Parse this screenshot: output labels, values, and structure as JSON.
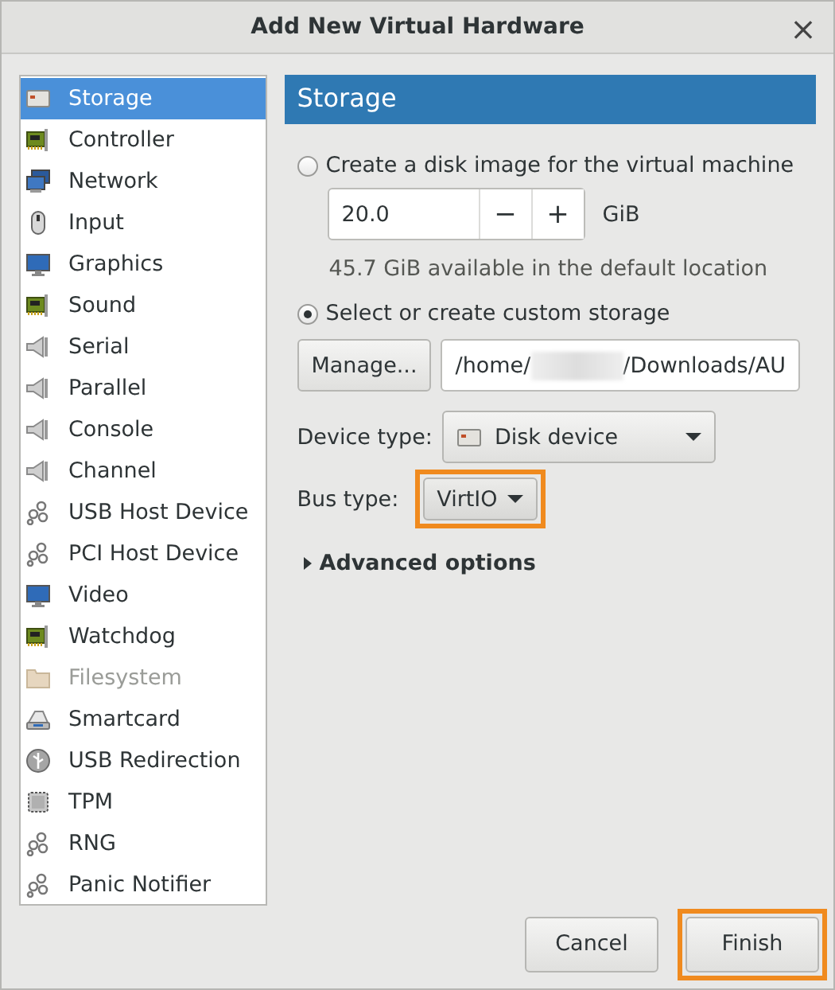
{
  "window": {
    "title": "Add New Virtual Hardware",
    "close": "×"
  },
  "sidebar": {
    "items": [
      {
        "label": "Storage",
        "kind": "disk",
        "selected": true,
        "disabled": false
      },
      {
        "label": "Controller",
        "kind": "card",
        "selected": false,
        "disabled": false
      },
      {
        "label": "Network",
        "kind": "network",
        "selected": false,
        "disabled": false
      },
      {
        "label": "Input",
        "kind": "mouse",
        "selected": false,
        "disabled": false
      },
      {
        "label": "Graphics",
        "kind": "monitor",
        "selected": false,
        "disabled": false
      },
      {
        "label": "Sound",
        "kind": "card",
        "selected": false,
        "disabled": false
      },
      {
        "label": "Serial",
        "kind": "plug",
        "selected": false,
        "disabled": false
      },
      {
        "label": "Parallel",
        "kind": "plug",
        "selected": false,
        "disabled": false
      },
      {
        "label": "Console",
        "kind": "plug",
        "selected": false,
        "disabled": false
      },
      {
        "label": "Channel",
        "kind": "plug",
        "selected": false,
        "disabled": false
      },
      {
        "label": "USB Host Device",
        "kind": "gears",
        "selected": false,
        "disabled": false
      },
      {
        "label": "PCI Host Device",
        "kind": "gears",
        "selected": false,
        "disabled": false
      },
      {
        "label": "Video",
        "kind": "monitor",
        "selected": false,
        "disabled": false
      },
      {
        "label": "Watchdog",
        "kind": "card",
        "selected": false,
        "disabled": false
      },
      {
        "label": "Filesystem",
        "kind": "folder",
        "selected": false,
        "disabled": true
      },
      {
        "label": "Smartcard",
        "kind": "reader",
        "selected": false,
        "disabled": false
      },
      {
        "label": "USB Redirection",
        "kind": "usb",
        "selected": false,
        "disabled": false
      },
      {
        "label": "TPM",
        "kind": "chip",
        "selected": false,
        "disabled": false
      },
      {
        "label": "RNG",
        "kind": "gears",
        "selected": false,
        "disabled": false
      },
      {
        "label": "Panic Notifier",
        "kind": "gears",
        "selected": false,
        "disabled": false
      }
    ]
  },
  "panel": {
    "title": "Storage",
    "create_option": {
      "label": "Create a disk image for the virtual machine",
      "selected": false
    },
    "size": {
      "value": "20.0",
      "minus": "−",
      "plus": "+",
      "unit": "GiB"
    },
    "available": "45.7 GiB available in the default location",
    "custom_option": {
      "label": "Select or create custom storage",
      "selected": true
    },
    "manage_button": "Manage...",
    "path": {
      "before": "/home/",
      "after": "/Downloads/AU",
      "redacted": true
    },
    "device_type": {
      "label": "Device type:",
      "value": "Disk device"
    },
    "bus_type": {
      "label": "Bus type:",
      "value": "VirtIO",
      "highlighted": true
    },
    "advanced": {
      "label": "Advanced options",
      "expanded": false
    }
  },
  "buttons": [
    {
      "label": "Cancel",
      "highlighted": false
    },
    {
      "label": "Finish",
      "highlighted": true
    }
  ]
}
